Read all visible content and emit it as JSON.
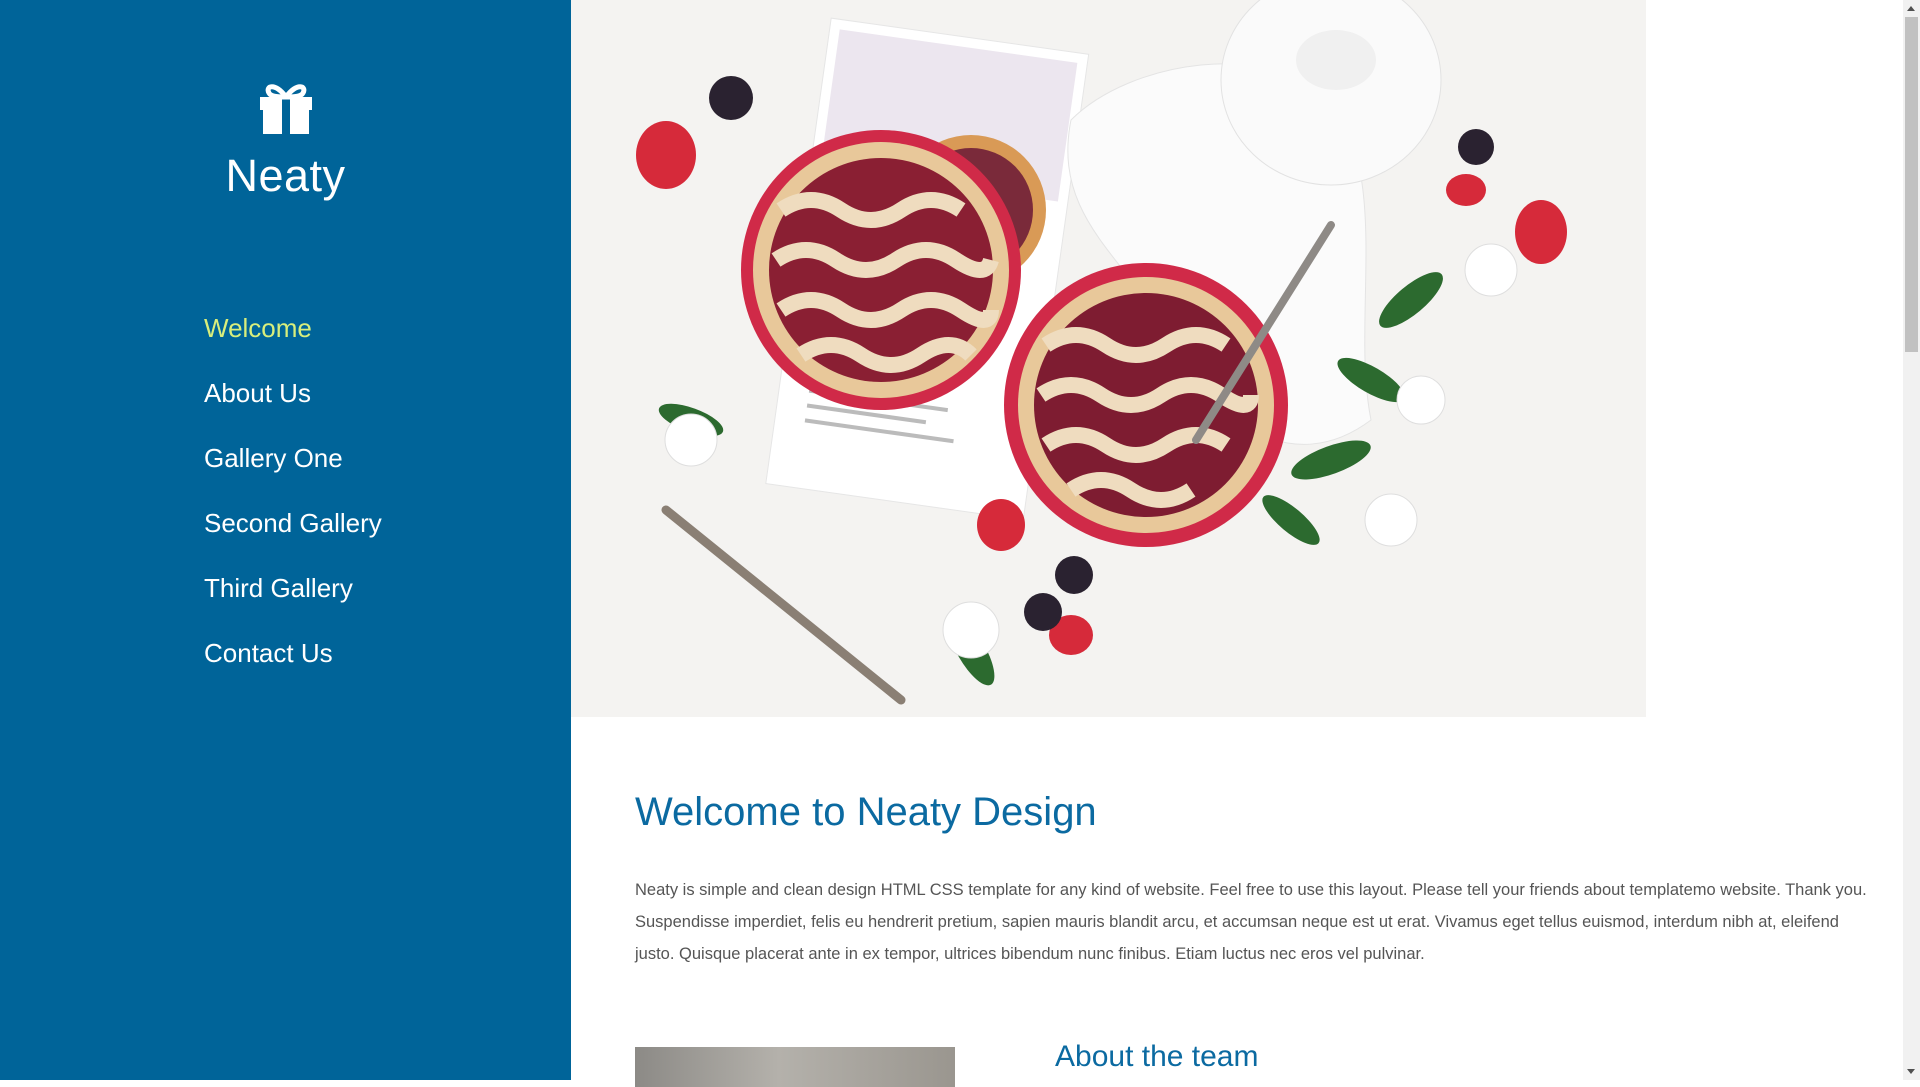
{
  "brand": {
    "name": "Neaty",
    "icon": "gift-icon"
  },
  "nav": {
    "items": [
      {
        "label": "Welcome",
        "active": true
      },
      {
        "label": "About Us"
      },
      {
        "label": "Gallery One"
      },
      {
        "label": "Second Gallery"
      },
      {
        "label": "Third Gallery"
      },
      {
        "label": "Contact Us"
      }
    ]
  },
  "hero": {
    "image": "pies-with-berries-photo"
  },
  "welcome": {
    "title": "Welcome to Neaty Design",
    "body": "Neaty is simple and clean design HTML CSS template for any kind of website. Feel free to use this layout. Please tell your friends about templatemo website. Thank you. Suspendisse imperdiet, felis eu hendrerit pretium, sapien mauris blandit arcu, et accumsan neque est ut erat. Vivamus eget tellus euismod, interdum nibh at, eleifend justo. Quisque placerat ante in ex tempor, ultrices bibendum nunc finibus. Etiam luctus nec eros vel pulvinar."
  },
  "team": {
    "heading": "About the team"
  },
  "colors": {
    "sidebar": "#006499",
    "active_nav": "#d8ee7c",
    "heading": "#0b6aa1"
  }
}
